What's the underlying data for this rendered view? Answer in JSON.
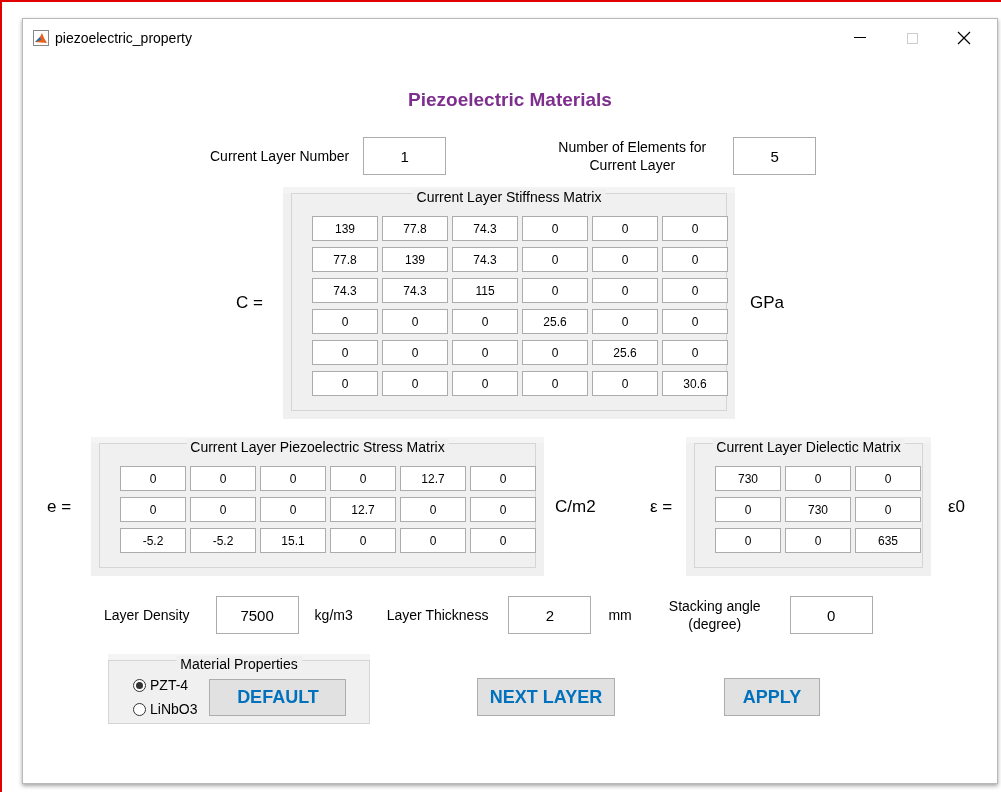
{
  "window": {
    "title": "piezoelectric_property"
  },
  "heading": "Piezoelectric Materials",
  "layer_number": {
    "label": "Current Layer Number",
    "value": "1"
  },
  "elements_count": {
    "label": "Number of Elements for Current Layer",
    "value": "5"
  },
  "stiffness": {
    "symbol": "C =",
    "title": "Current Layer Stiffness Matrix",
    "unit": "GPa",
    "rows": [
      [
        "139",
        "77.8",
        "74.3",
        "0",
        "0",
        "0"
      ],
      [
        "77.8",
        "139",
        "74.3",
        "0",
        "0",
        "0"
      ],
      [
        "74.3",
        "74.3",
        "115",
        "0",
        "0",
        "0"
      ],
      [
        "0",
        "0",
        "0",
        "25.6",
        "0",
        "0"
      ],
      [
        "0",
        "0",
        "0",
        "0",
        "25.6",
        "0"
      ],
      [
        "0",
        "0",
        "0",
        "0",
        "0",
        "30.6"
      ]
    ]
  },
  "piezo": {
    "symbol": "e =",
    "title": "Current Layer Piezoelectric Stress Matrix",
    "unit": "C/m2",
    "rows": [
      [
        "0",
        "0",
        "0",
        "0",
        "12.7",
        "0"
      ],
      [
        "0",
        "0",
        "0",
        "12.7",
        "0",
        "0"
      ],
      [
        "-5.2",
        "-5.2",
        "15.1",
        "0",
        "0",
        "0"
      ]
    ]
  },
  "dielectric": {
    "symbol": "ε =",
    "title": "Current Layer Dielectic Matrix",
    "unit": "ε0",
    "rows": [
      [
        "730",
        "0",
        "0"
      ],
      [
        "0",
        "730",
        "0"
      ],
      [
        "0",
        "0",
        "635"
      ]
    ]
  },
  "properties": [
    {
      "label": "Layer Density",
      "value": "7500",
      "unit": "kg/m3"
    },
    {
      "label": "Layer Thickness",
      "value": "2",
      "unit": "mm"
    },
    {
      "label": "Stacking angle (degree)",
      "value": "0"
    }
  ],
  "material_properties": {
    "title": "Material Properties",
    "options": [
      {
        "label": "PZT-4",
        "selected": true
      },
      {
        "label": "LiNbO3",
        "selected": false
      }
    ],
    "button": "DEFAULT"
  },
  "buttons": [
    "NEXT LAYER",
    "APPLY"
  ]
}
